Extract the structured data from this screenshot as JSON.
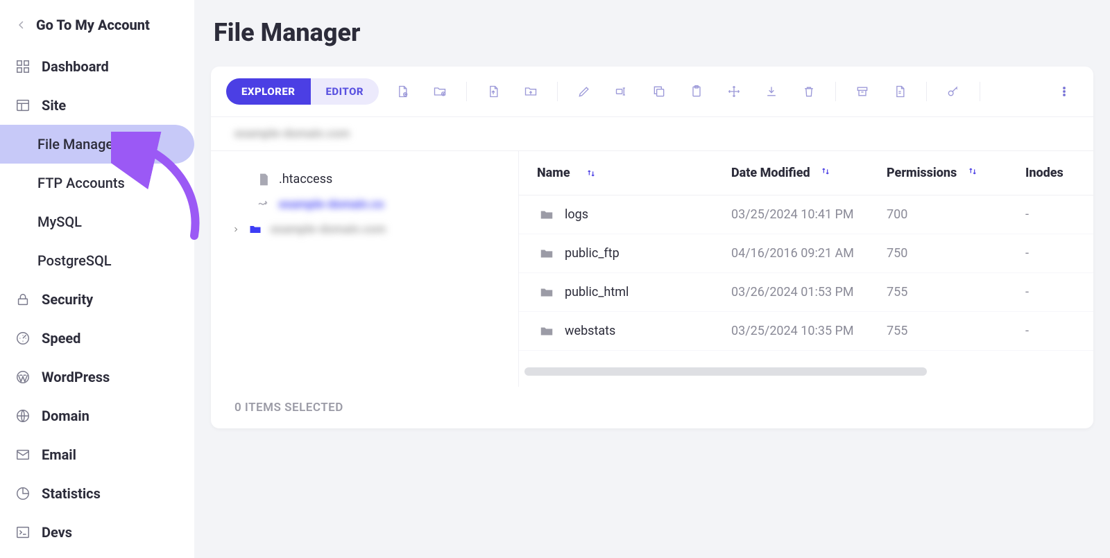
{
  "sidebar": {
    "back_label": "Go To My Account",
    "items": [
      {
        "label": "Dashboard",
        "icon": "grid"
      },
      {
        "label": "Site",
        "icon": "layout",
        "children": [
          {
            "label": "File Manager",
            "active": true
          },
          {
            "label": "FTP Accounts"
          },
          {
            "label": "MySQL"
          },
          {
            "label": "PostgreSQL"
          }
        ]
      },
      {
        "label": "Security",
        "icon": "lock"
      },
      {
        "label": "Speed",
        "icon": "gauge"
      },
      {
        "label": "WordPress",
        "icon": "wp"
      },
      {
        "label": "Domain",
        "icon": "globe"
      },
      {
        "label": "Email",
        "icon": "mail"
      },
      {
        "label": "Statistics",
        "icon": "pie"
      },
      {
        "label": "Devs",
        "icon": "terminal"
      }
    ]
  },
  "page": {
    "title": "File Manager"
  },
  "toolbar": {
    "mode_explorer": "EXPLORER",
    "mode_editor": "EDITOR",
    "icons": [
      "new-file",
      "new-folder",
      "sep",
      "upload-file",
      "upload-folder",
      "sep",
      "edit",
      "rename",
      "copy",
      "paste",
      "move",
      "download",
      "delete",
      "sep",
      "archive",
      "extract",
      "sep",
      "permissions",
      "sep"
    ]
  },
  "breadcrumb": {
    "path_masked": "example-domain.com"
  },
  "tree": {
    "items": [
      {
        "name": ".htaccess",
        "type": "file"
      },
      {
        "name": "example-domain.co",
        "type": "share",
        "masked": true
      },
      {
        "name": "example-domain.com",
        "type": "folder",
        "masked": true,
        "expandable": true
      }
    ]
  },
  "table": {
    "headers": {
      "name": "Name",
      "date": "Date Modified",
      "perm": "Permissions",
      "inodes": "Inodes"
    },
    "rows": [
      {
        "name": "logs",
        "date": "03/25/2024 10:41 PM",
        "perm": "700",
        "inodes": "-"
      },
      {
        "name": "public_ftp",
        "date": "04/16/2016 09:21 AM",
        "perm": "750",
        "inodes": "-"
      },
      {
        "name": "public_html",
        "date": "03/26/2024 01:53 PM",
        "perm": "755",
        "inodes": "-"
      },
      {
        "name": "webstats",
        "date": "03/25/2024 10:35 PM",
        "perm": "755",
        "inodes": "-"
      }
    ]
  },
  "status": {
    "selected_text": "0 ITEMS SELECTED"
  }
}
